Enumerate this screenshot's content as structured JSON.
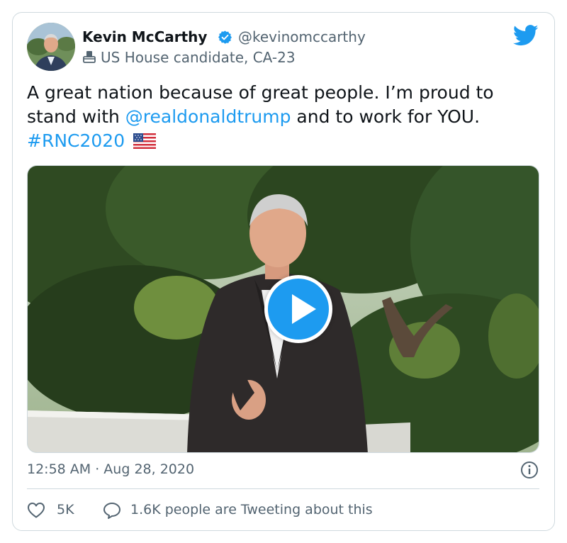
{
  "colors": {
    "accent": "#1d9bf0",
    "text_primary": "#0f1419",
    "text_secondary": "#536471",
    "border": "#cfd9de"
  },
  "author": {
    "name": "Kevin McCarthy",
    "handle": "@kevinomccarthy",
    "label": "US House candidate, CA-23",
    "verified_icon": "verified-badge-icon",
    "label_icon": "ballot-box-icon"
  },
  "tweet": {
    "text_part1": "A great nation because of great people. I’m proud to stand with ",
    "mention": "@realdonaldtrump",
    "text_part2": " and to work for YOU.",
    "hashtag": "#RNC2020",
    "emoji_icon": "us-flag-icon"
  },
  "media": {
    "type": "video",
    "play_icon": "play-icon"
  },
  "meta": {
    "timestamp": "12:58 AM · Aug 28, 2020",
    "info_icon": "info-icon"
  },
  "actions": {
    "likes": "5K",
    "talk_text": "1.6K people are Tweeting about this",
    "like_icon": "heart-icon",
    "reply_icon": "speech-bubble-icon"
  },
  "brand_icon": "twitter-bird-icon"
}
